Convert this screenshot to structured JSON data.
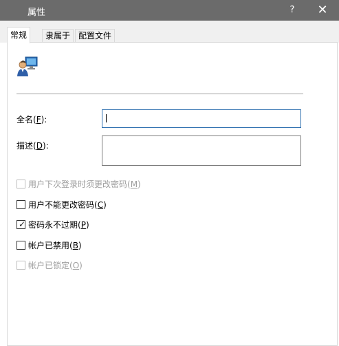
{
  "window": {
    "title": "属性",
    "help_icon": "?",
    "close_icon": "✕"
  },
  "tabs": [
    {
      "label": "常规",
      "active": true
    },
    {
      "label": "隶属于",
      "active": false
    },
    {
      "label": "配置文件",
      "active": false
    }
  ],
  "general": {
    "icon": "user-computer-icon",
    "fullname": {
      "label_prefix": "全名(",
      "accel": "F",
      "label_suffix": "):",
      "value": ""
    },
    "description": {
      "label_prefix": "描述(",
      "accel": "D",
      "label_suffix": "):",
      "value": ""
    },
    "checks": [
      {
        "prefix": "用户下次登录时须更改密码(",
        "accel": "M",
        "suffix": ")",
        "checked": false,
        "disabled": true
      },
      {
        "prefix": "用户不能更改密码(",
        "accel": "C",
        "suffix": ")",
        "checked": false,
        "disabled": false
      },
      {
        "prefix": "密码永不过期(",
        "accel": "P",
        "suffix": ")",
        "checked": true,
        "disabled": false
      },
      {
        "prefix": "帐户已禁用(",
        "accel": "B",
        "suffix": ")",
        "checked": false,
        "disabled": false
      },
      {
        "prefix": "帐户已锁定(",
        "accel": "O",
        "suffix": ")",
        "checked": false,
        "disabled": true
      }
    ],
    "checkmark": "✓"
  },
  "colors": {
    "titlebar": "#6b6b6b",
    "focus_border": "#2b6dae",
    "disabled_text": "#9d9d9d"
  }
}
